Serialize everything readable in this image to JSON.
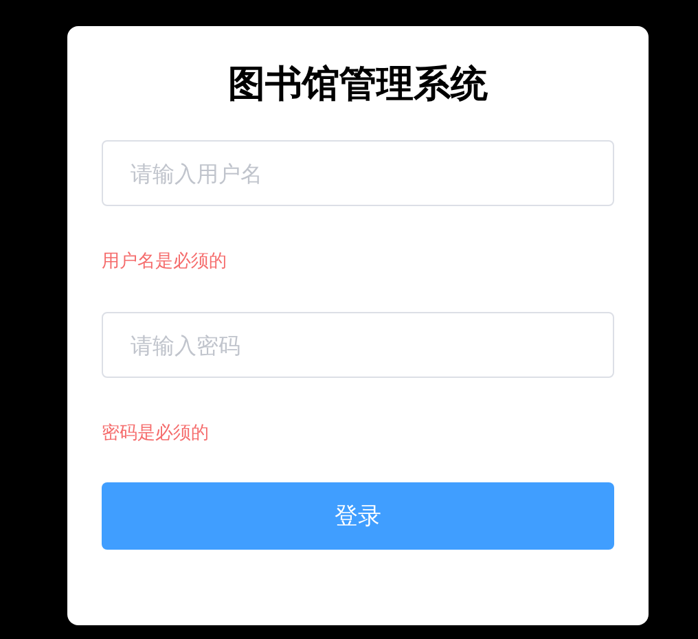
{
  "title": "图书馆管理系统",
  "fields": [
    {
      "placeholder": "请输入用户名",
      "error": "用户名是必须的"
    },
    {
      "placeholder": "请输入密码",
      "error": "密码是必须的"
    }
  ],
  "button": "登录"
}
